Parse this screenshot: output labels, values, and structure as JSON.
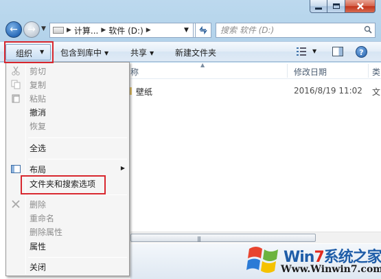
{
  "nav": {
    "back_glyph": "←",
    "forward_glyph": "→",
    "breadcrumbs": [
      "计算...",
      "软件 (D:)"
    ],
    "search_placeholder": "搜索 软件 (D:)"
  },
  "toolbar": {
    "organize": "组织",
    "include_in_library": "包含到库中",
    "share": "共享",
    "new_folder": "新建文件夹",
    "help": "?"
  },
  "columns": {
    "name": "称",
    "date_modified": "修改日期",
    "type_partial": "类"
  },
  "files": [
    {
      "name": "壁纸",
      "date": "2016/8/19 11:02",
      "type_partial": "文"
    }
  ],
  "menu": {
    "cut": "剪切",
    "copy": "复制",
    "paste": "粘贴",
    "undo": "撤消",
    "redo": "恢复",
    "select_all": "全选",
    "layout": "布局",
    "folder_options": "文件夹和搜索选项",
    "delete": "删除",
    "rename": "重命名",
    "remove_properties": "删除属性",
    "properties": "属性",
    "close": "关闭"
  },
  "watermark": {
    "brand_prefix": "Win",
    "brand_num": "7",
    "brand_suffix": "系统之家",
    "url": "Www.Winwin7.com"
  },
  "colors": {
    "highlight_box": "#d8262d",
    "accent": "#1f5da8"
  }
}
